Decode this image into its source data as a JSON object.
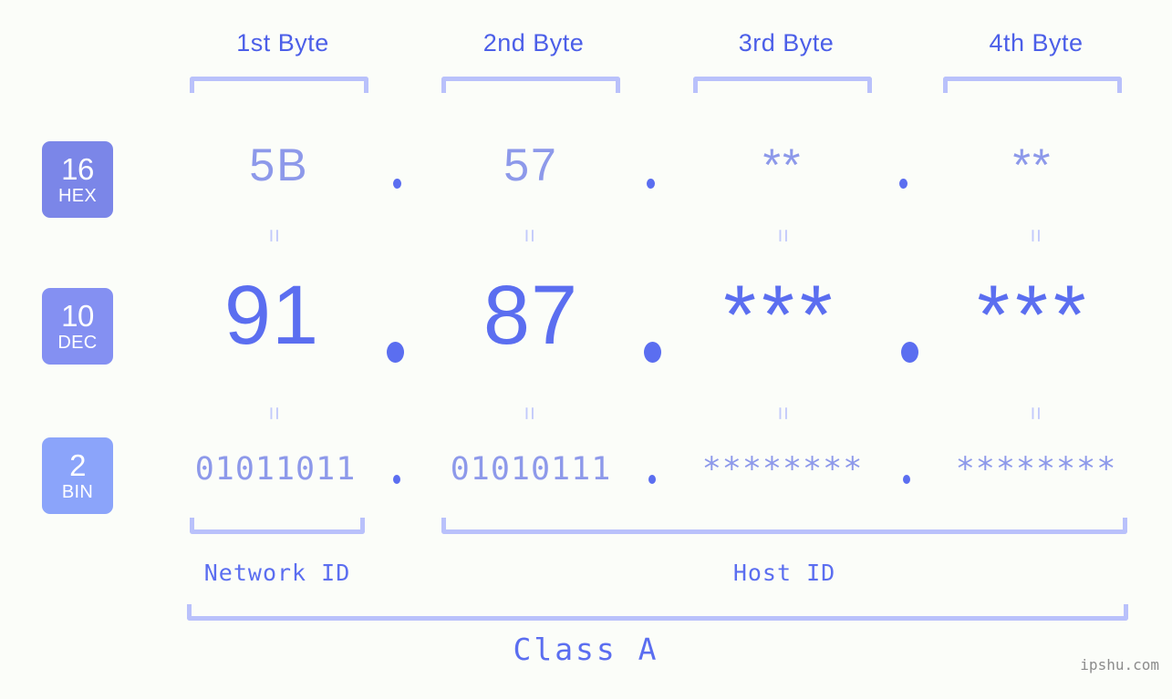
{
  "page": {
    "background_color": "#fbfdf9",
    "accent_strong": "#5b6ef0",
    "accent_light": "#8d99ea",
    "bracket_color": "#b9c1fb",
    "watermark": "ipshu.com"
  },
  "byte_headers": [
    {
      "label": "1st Byte"
    },
    {
      "label": "2nd Byte"
    },
    {
      "label": "3rd Byte"
    },
    {
      "label": "4th Byte"
    }
  ],
  "bases": [
    {
      "num": "16",
      "name": "HEX",
      "color": "#7b86e8"
    },
    {
      "num": "10",
      "name": "DEC",
      "color": "#8490f2"
    },
    {
      "num": "2",
      "name": "BIN",
      "color": "#8ba4fa"
    }
  ],
  "rows": {
    "hex": {
      "base_num": "16",
      "base_name": "HEX",
      "values": [
        "5B",
        "57",
        "**",
        "**"
      ],
      "separator": "."
    },
    "dec": {
      "base_num": "10",
      "base_name": "DEC",
      "values": [
        "91",
        "87",
        "***",
        "***"
      ],
      "separator": "."
    },
    "bin": {
      "base_num": "2",
      "base_name": "BIN",
      "values": [
        "01011011",
        "01010111",
        "********",
        "********"
      ],
      "separator": "."
    }
  },
  "equals_marks": {
    "glyph": "=",
    "count_per_gap": 4
  },
  "sections": {
    "network_id": "Network ID",
    "host_id": "Host ID",
    "class": "Class A"
  }
}
